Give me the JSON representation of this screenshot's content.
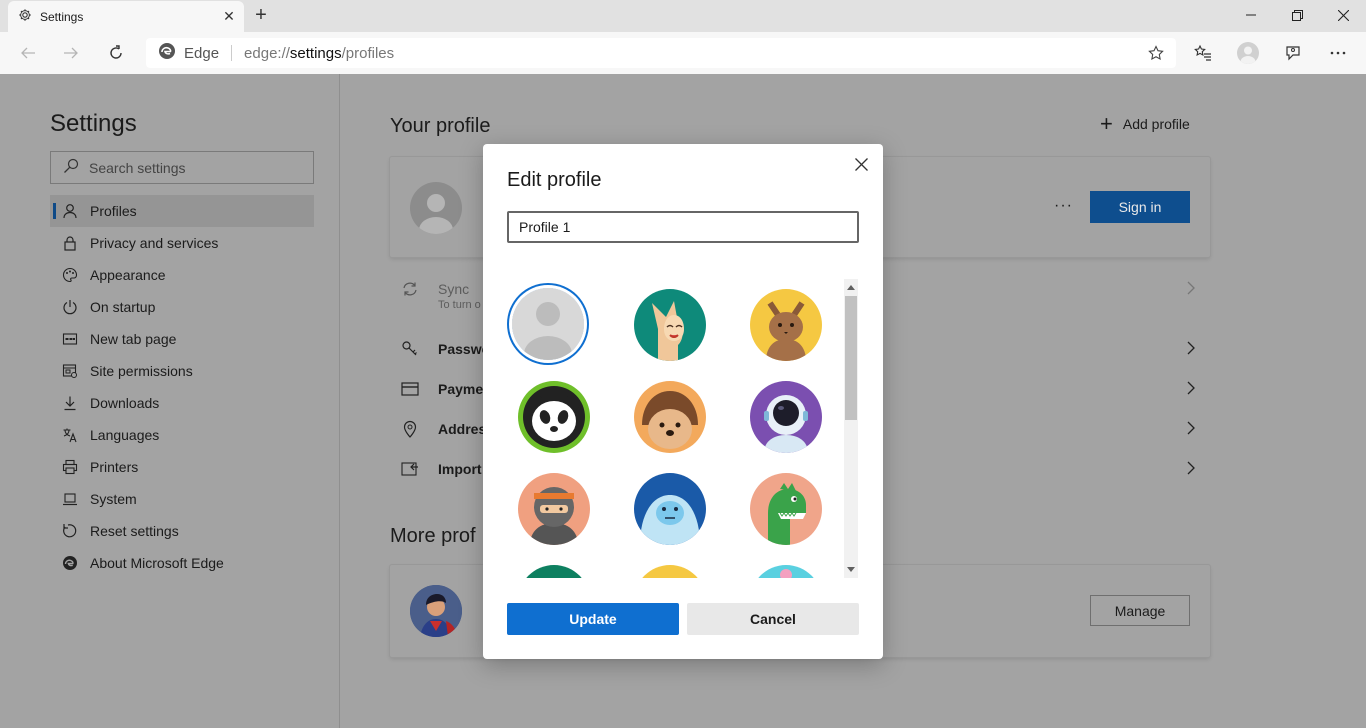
{
  "browser": {
    "tab_title": "Settings",
    "site_name": "Edge",
    "url_scheme": "edge://",
    "url_host": "settings",
    "url_path": "/profiles"
  },
  "sidebar": {
    "title": "Settings",
    "search_placeholder": "Search settings",
    "items": [
      {
        "label": "Profiles",
        "icon": "person-icon",
        "active": true
      },
      {
        "label": "Privacy and services",
        "icon": "lock-icon"
      },
      {
        "label": "Appearance",
        "icon": "palette-icon"
      },
      {
        "label": "On startup",
        "icon": "power-icon"
      },
      {
        "label": "New tab page",
        "icon": "newtab-icon"
      },
      {
        "label": "Site permissions",
        "icon": "site-permissions-icon"
      },
      {
        "label": "Downloads",
        "icon": "download-icon"
      },
      {
        "label": "Languages",
        "icon": "languages-icon"
      },
      {
        "label": "Printers",
        "icon": "printer-icon"
      },
      {
        "label": "System",
        "icon": "laptop-icon"
      },
      {
        "label": "Reset settings",
        "icon": "reset-icon"
      },
      {
        "label": "About Microsoft Edge",
        "icon": "edge-logo-icon"
      }
    ]
  },
  "main": {
    "your_profile_title": "Your profile",
    "add_profile_label": "Add profile",
    "sign_in_label": "Sign in",
    "more_dots": "···",
    "rows": {
      "sync": "Sync",
      "sync_sub": "To turn o",
      "passwords": "Passwo",
      "payment": "Paymen",
      "addresses": "Addres",
      "import": "Import"
    },
    "more_profiles_title": "More prof",
    "manage_label": "Manage"
  },
  "dialog": {
    "title": "Edit profile",
    "name_value": "Profile 1",
    "update_label": "Update",
    "cancel_label": "Cancel",
    "avatars": [
      "default-person-avatar",
      "fox-avatar",
      "cat-avatar",
      "panda-avatar",
      "hedgehog-avatar",
      "astronaut-avatar",
      "ninja-avatar",
      "yeti-avatar",
      "dinosaur-avatar",
      "leaf-avatar",
      "sun-avatar",
      "flower-avatar"
    ],
    "selected_avatar": "default-person-avatar"
  },
  "colors": {
    "accent": "#0f6fd0",
    "overlay_page": "#a3a3a3",
    "signin_dimmed": "#0e4e8e"
  }
}
